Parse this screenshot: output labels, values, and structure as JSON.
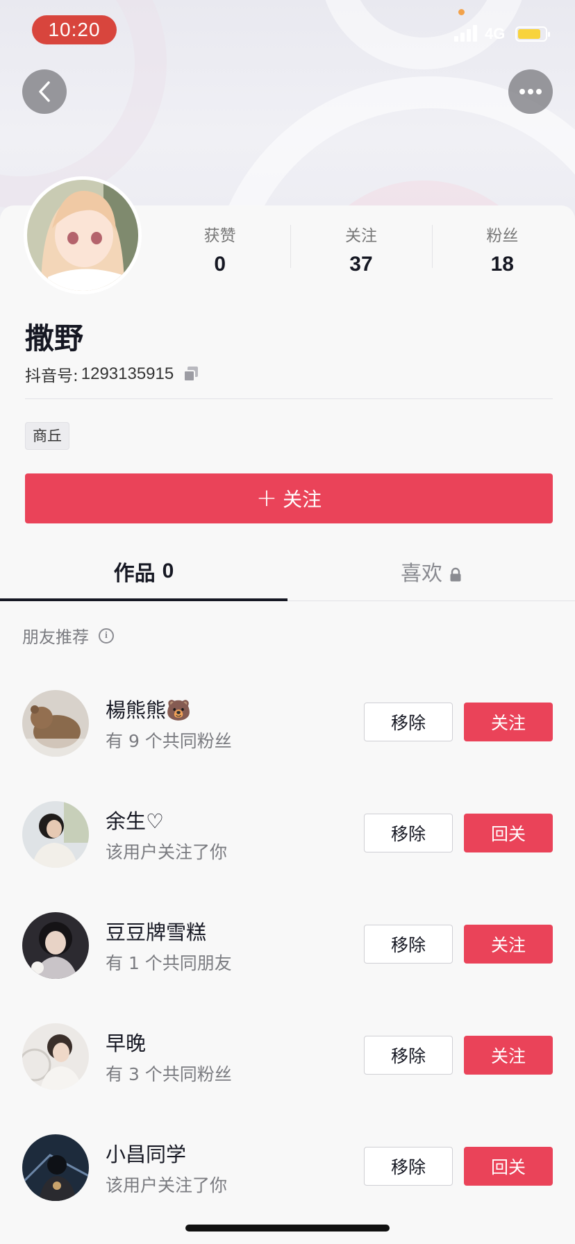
{
  "status_bar": {
    "time": "10:20",
    "network": "4G",
    "battery_level": 0.85,
    "colors": {
      "time_pill": "#d8453d",
      "battery": "#f8d33c",
      "dot": "#f2a24a"
    }
  },
  "header": {
    "back_icon": "chevron-left-icon",
    "more_icon": "more-dots-icon"
  },
  "profile": {
    "nickname": "撒野",
    "douyin_id_label": "抖音号:",
    "douyin_id": "1293135915",
    "location_tag": "商丘",
    "follow_button": "关注",
    "stats": [
      {
        "label": "获赞",
        "value": "0"
      },
      {
        "label": "关注",
        "value": "37"
      },
      {
        "label": "粉丝",
        "value": "18"
      }
    ]
  },
  "tabs": [
    {
      "label": "作品",
      "count": "0",
      "active": true
    },
    {
      "label": "喜欢",
      "locked": true,
      "active": false
    }
  ],
  "recommendations": {
    "title": "朋友推荐",
    "remove_label": "移除",
    "items": [
      {
        "name": "楊熊熊🐻",
        "subtitle": "有 9 个共同粉丝",
        "action": "关注"
      },
      {
        "name": "余生♡",
        "subtitle": "该用户关注了你",
        "action": "回关"
      },
      {
        "name": "豆豆牌雪糕",
        "subtitle": "有 1 个共同朋友",
        "action": "关注"
      },
      {
        "name": "早晚",
        "subtitle": "有 3 个共同粉丝",
        "action": "关注"
      },
      {
        "name": "小昌同学",
        "subtitle": "该用户关注了你",
        "action": "回关"
      }
    ]
  },
  "theme": {
    "accent": "#ea4359",
    "text": "#161823",
    "muted": "#7a7b80"
  }
}
